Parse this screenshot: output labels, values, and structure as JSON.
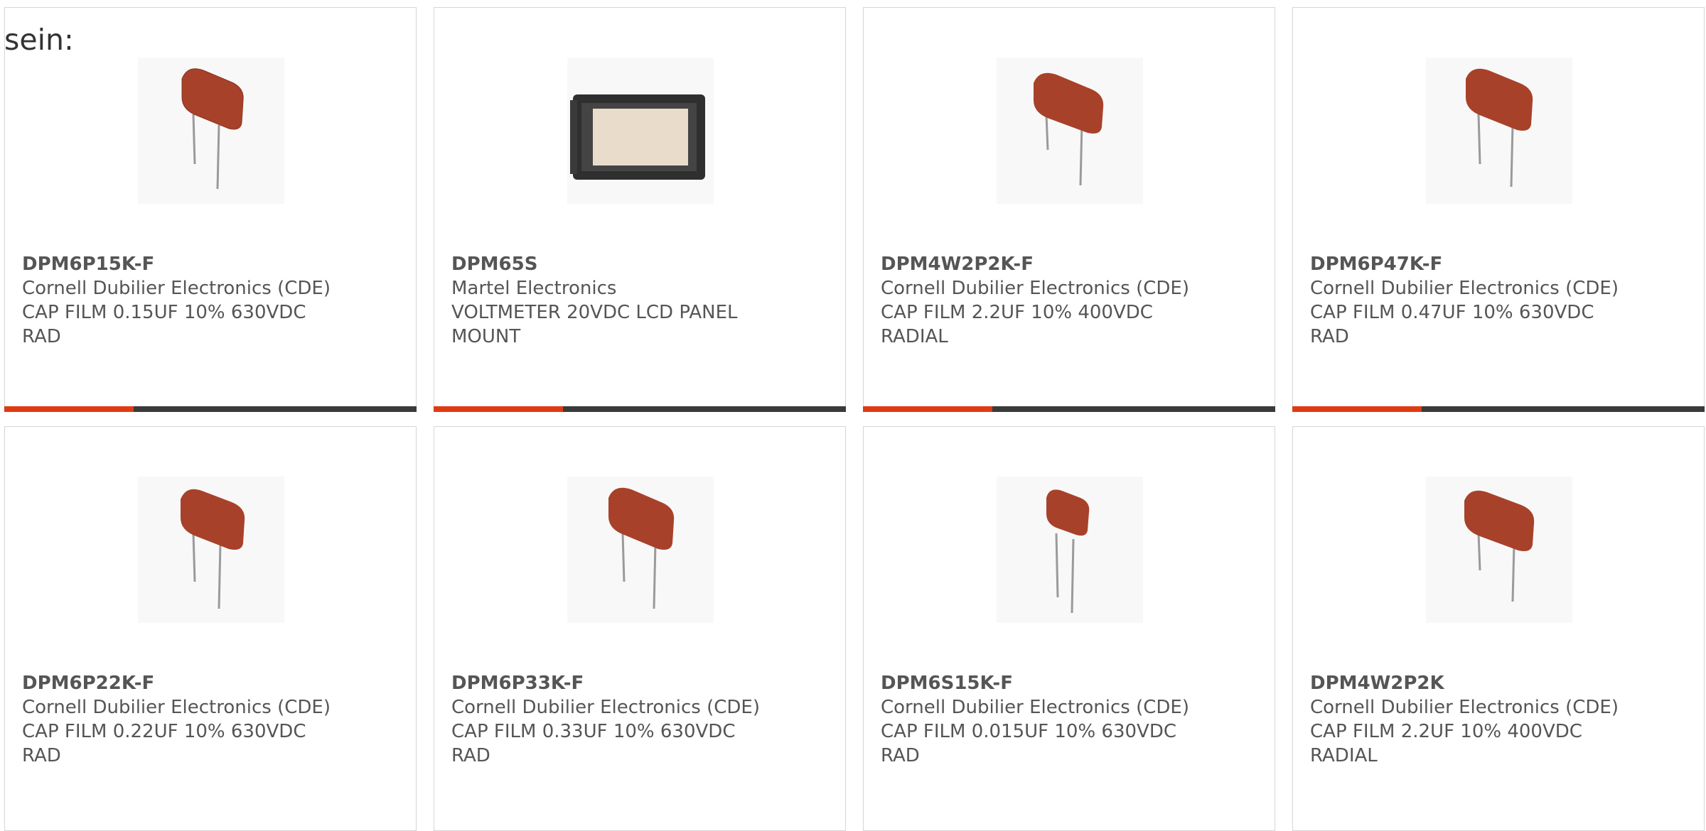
{
  "intro_text": "sein:",
  "colors": {
    "accent": "#e03a12",
    "bar": "#3a3a3a",
    "capacitor": "#a8412a"
  },
  "products": [
    {
      "part_number": "DPM6P15K-F",
      "manufacturer": "Cornell Dubilier Electronics (CDE)",
      "description_line1": "CAP FILM 0.15UF 10% 630VDC",
      "description_line2": "RAD",
      "image_icon": "film-capacitor-icon"
    },
    {
      "part_number": "DPM65S",
      "manufacturer": "Martel Electronics",
      "description_line1": "VOLTMETER 20VDC LCD PANEL",
      "description_line2": "MOUNT",
      "image_icon": "panel-meter-icon"
    },
    {
      "part_number": "DPM4W2P2K-F",
      "manufacturer": "Cornell Dubilier Electronics (CDE)",
      "description_line1": "CAP FILM 2.2UF 10% 400VDC",
      "description_line2": "RADIAL",
      "image_icon": "film-capacitor-icon"
    },
    {
      "part_number": "DPM6P47K-F",
      "manufacturer": "Cornell Dubilier Electronics (CDE)",
      "description_line1": "CAP FILM 0.47UF 10% 630VDC",
      "description_line2": "RAD",
      "image_icon": "film-capacitor-icon"
    },
    {
      "part_number": "DPM6P22K-F",
      "manufacturer": "Cornell Dubilier Electronics (CDE)",
      "description_line1": "CAP FILM 0.22UF 10% 630VDC",
      "description_line2": "RAD",
      "image_icon": "film-capacitor-icon"
    },
    {
      "part_number": "DPM6P33K-F",
      "manufacturer": "Cornell Dubilier Electronics (CDE)",
      "description_line1": "CAP FILM 0.33UF 10% 630VDC",
      "description_line2": "RAD",
      "image_icon": "film-capacitor-icon"
    },
    {
      "part_number": "DPM6S15K-F",
      "manufacturer": "Cornell Dubilier Electronics (CDE)",
      "description_line1": "CAP FILM 0.015UF 10% 630VDC",
      "description_line2": "RAD",
      "image_icon": "film-capacitor-icon"
    },
    {
      "part_number": "DPM4W2P2K",
      "manufacturer": "Cornell Dubilier Electronics (CDE)",
      "description_line1": "CAP FILM 2.2UF 10% 400VDC",
      "description_line2": "RADIAL",
      "image_icon": "film-capacitor-icon"
    }
  ]
}
